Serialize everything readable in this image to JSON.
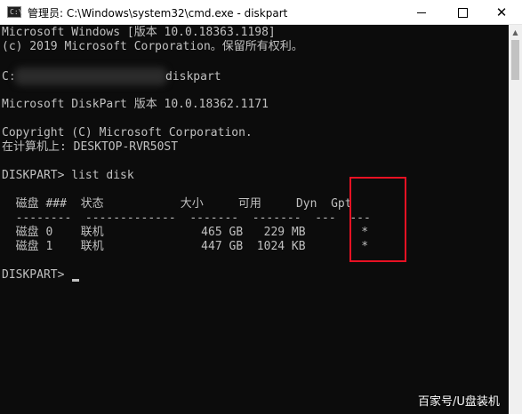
{
  "window": {
    "title": "管理员: C:\\Windows\\system32\\cmd.exe - diskpart",
    "icon": "cmd-icon",
    "controls": {
      "minimize": "minimize-icon",
      "maximize": "maximize-icon",
      "close": "✕"
    }
  },
  "console": {
    "lines": [
      "Microsoft Windows [版本 10.0.18363.1198]",
      "(c) 2019 Microsoft Corporation。保留所有权利。",
      "C:",
      "diskpart",
      "Microsoft DiskPart 版本 10.0.18362.1171",
      "Copyright (C) Microsoft Corporation.",
      "在计算机上: DESKTOP-RVR50ST",
      "DISKPART> list disk",
      "  磁盘 ###  状态           大小     可用     Dyn  Gpt",
      "  --------  -------------  -------  -------  ---  ---",
      "  磁盘 0    联机              465 GB   229 MB        *",
      "  磁盘 1    联机              447 GB  1024 KB        *",
      "DISKPART> "
    ]
  },
  "highlight_color": "#e81123",
  "watermark": "百家号/U盘装机"
}
